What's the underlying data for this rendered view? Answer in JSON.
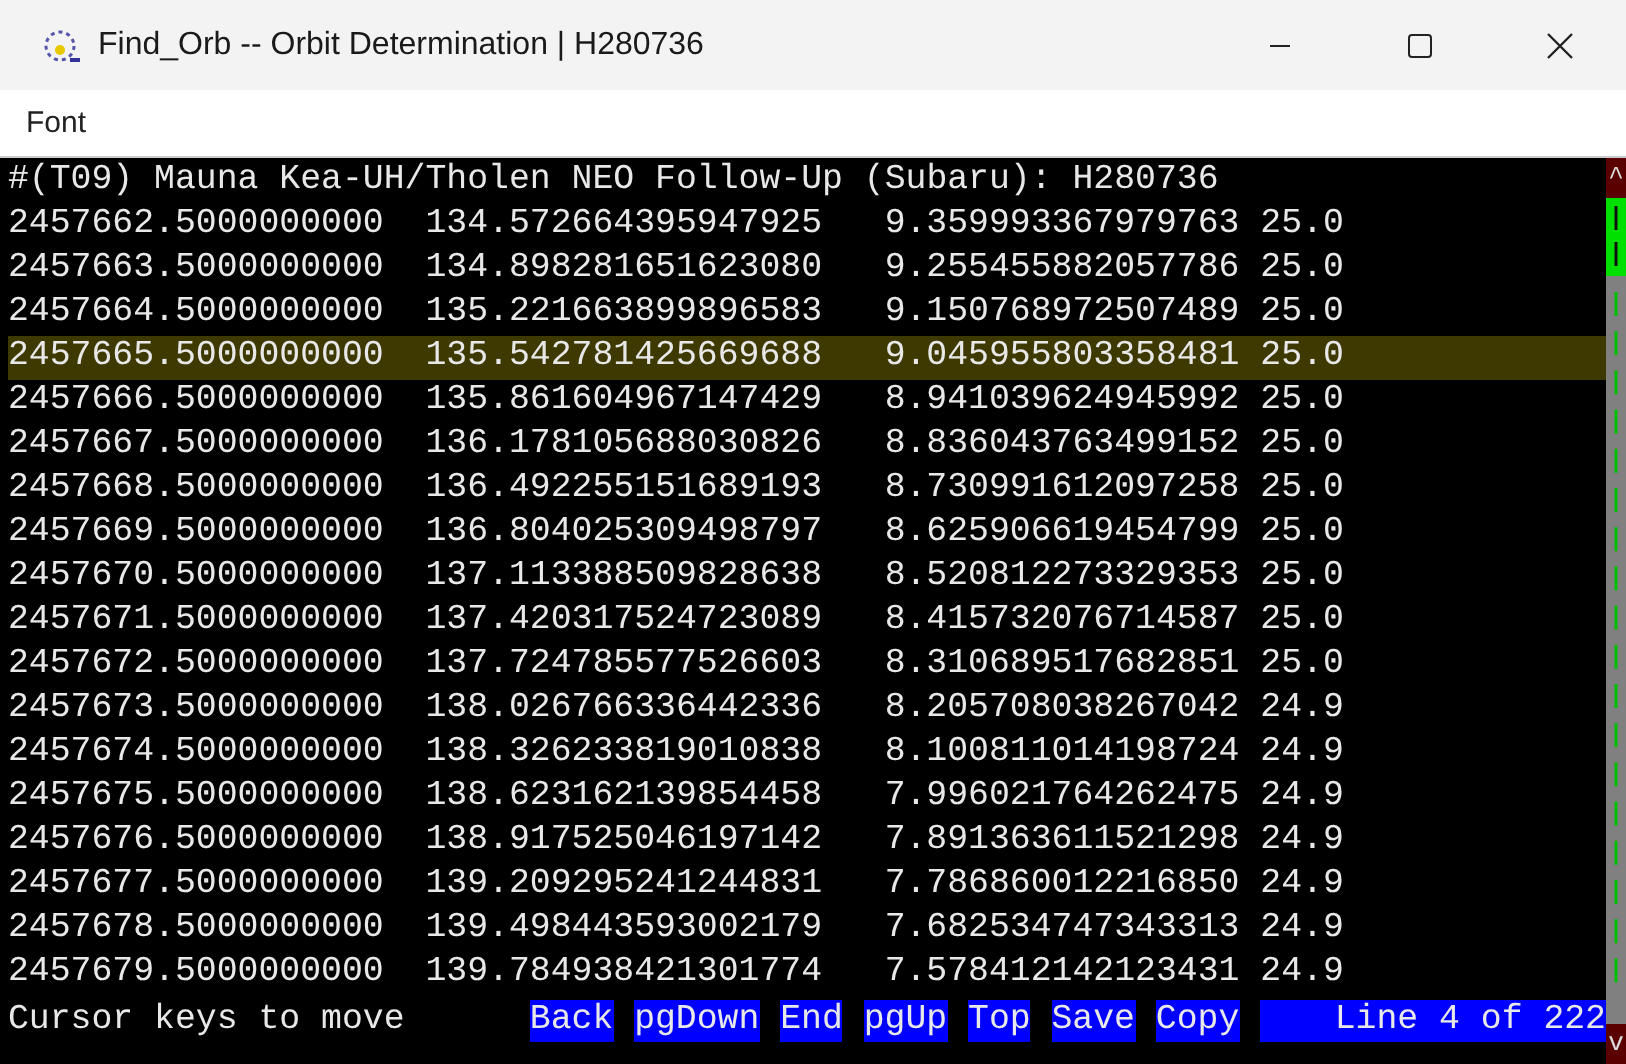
{
  "window": {
    "title": "Find_Orb -- Orbit Determination | H280736"
  },
  "menu": [
    {
      "label": "Font"
    }
  ],
  "header": "#(T09) Mauna Kea-UH/Tholen NEO Follow-Up (Subaru): H280736",
  "rows": [
    {
      "cells": [
        "2457662.5000000000",
        "134.572664395947925",
        "9.359993367979763",
        "25.0"
      ],
      "selected": false
    },
    {
      "cells": [
        "2457663.5000000000",
        "134.898281651623080",
        "9.255455882057786",
        "25.0"
      ],
      "selected": false
    },
    {
      "cells": [
        "2457664.5000000000",
        "135.221663899896583",
        "9.150768972507489",
        "25.0"
      ],
      "selected": false
    },
    {
      "cells": [
        "2457665.5000000000",
        "135.542781425669688",
        "9.045955803358481",
        "25.0"
      ],
      "selected": true
    },
    {
      "cells": [
        "2457666.5000000000",
        "135.861604967147429",
        "8.941039624945992",
        "25.0"
      ],
      "selected": false
    },
    {
      "cells": [
        "2457667.5000000000",
        "136.178105688030826",
        "8.836043763499152",
        "25.0"
      ],
      "selected": false
    },
    {
      "cells": [
        "2457668.5000000000",
        "136.492255151689193",
        "8.730991612097258",
        "25.0"
      ],
      "selected": false
    },
    {
      "cells": [
        "2457669.5000000000",
        "136.804025309498797",
        "8.625906619454799",
        "25.0"
      ],
      "selected": false
    },
    {
      "cells": [
        "2457670.5000000000",
        "137.113388509828638",
        "8.520812273329353",
        "25.0"
      ],
      "selected": false
    },
    {
      "cells": [
        "2457671.5000000000",
        "137.420317524723089",
        "8.415732076714587",
        "25.0"
      ],
      "selected": false
    },
    {
      "cells": [
        "2457672.5000000000",
        "137.724785577526603",
        "8.310689517682851",
        "25.0"
      ],
      "selected": false
    },
    {
      "cells": [
        "2457673.5000000000",
        "138.026766336442336",
        "8.205708038267042",
        "24.9"
      ],
      "selected": false
    },
    {
      "cells": [
        "2457674.5000000000",
        "138.326233819010838",
        "8.100811014198724",
        "24.9"
      ],
      "selected": false
    },
    {
      "cells": [
        "2457675.5000000000",
        "138.623162139854458",
        "7.996021764262475",
        "24.9"
      ],
      "selected": false
    },
    {
      "cells": [
        "2457676.5000000000",
        "138.917525046197142",
        "7.891363611521298",
        "24.9"
      ],
      "selected": false
    },
    {
      "cells": [
        "2457677.5000000000",
        "139.209295241244831",
        "7.786860012216850",
        "24.9"
      ],
      "selected": false
    },
    {
      "cells": [
        "2457678.5000000000",
        "139.498443593002179",
        "7.682534747343313",
        "24.9"
      ],
      "selected": false
    },
    {
      "cells": [
        "2457679.5000000000",
        "139.784938421301774",
        "7.578412142123431",
        "24.9"
      ],
      "selected": false
    }
  ],
  "scroll_up": "^",
  "scroll_down": "v",
  "status": {
    "hint": "Cursor keys to move",
    "buttons": [
      "Back",
      "pgDown",
      "End",
      "pgUp",
      "Top",
      "Save",
      "Copy"
    ],
    "position": "Line 4 of 222"
  }
}
